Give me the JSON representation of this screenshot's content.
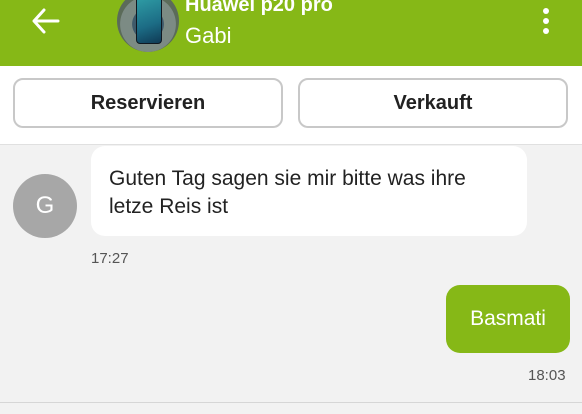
{
  "header": {
    "listing_title": "Huawei p20 pro",
    "partner_name": "Gabi",
    "background_color": "#86b817",
    "back_icon": "arrow-left-icon",
    "menu_icon": "more-vertical-icon"
  },
  "actions": {
    "reserve_label": "Reservieren",
    "sold_label": "Verkauft"
  },
  "messages": [
    {
      "direction": "incoming",
      "avatar_letter": "G",
      "text_line1": "Guten Tag sagen sie mir bitte was ihre",
      "text_line2": "letze Reis ist",
      "time": "17:27"
    },
    {
      "direction": "outgoing",
      "text": "Basmati",
      "time": "18:03"
    }
  ]
}
